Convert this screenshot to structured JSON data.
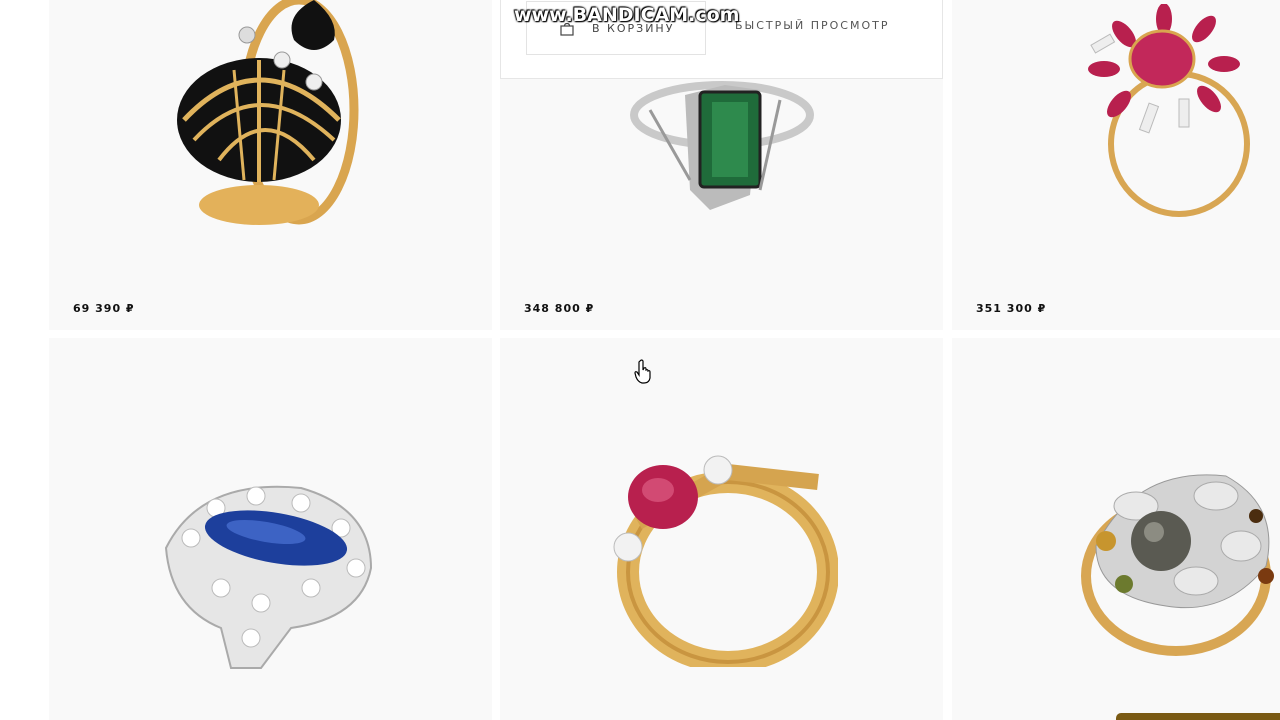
{
  "watermark": "www.BANDICAM.com",
  "quick_actions": {
    "cart_label": "В КОРЗИНУ",
    "quick_view_label": "БЫСТРЫЙ ПРОСМОТР"
  },
  "products": [
    {
      "price": "69 390 ₽",
      "description": "gold ring with black enamel shells"
    },
    {
      "price": "348 800 ₽",
      "description": "white gold ring with emerald"
    },
    {
      "price": "351 300 ₽",
      "description": "gold ring with ruby flower"
    },
    {
      "price": "",
      "description": "white gold ring with sapphire"
    },
    {
      "price": "",
      "description": "gold ring with ruby and diamonds"
    },
    {
      "price": "",
      "description": "ring with pearl and gems"
    }
  ],
  "colors": {
    "card_bg": "#f9f9f9",
    "gold": "#e0b35c",
    "emerald": "#1f6b3a",
    "ruby": "#b8204e",
    "sapphire": "#1d3f9c",
    "chat_tab": "#7a5a14"
  }
}
